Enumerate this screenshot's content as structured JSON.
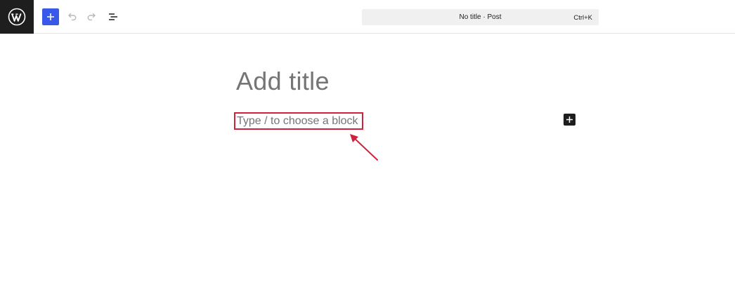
{
  "header": {
    "logo_icon": "wordpress-icon",
    "add_block_icon": "plus-icon",
    "undo_icon": "undo-icon",
    "redo_icon": "redo-icon",
    "document_overview_icon": "list-view-icon",
    "command_bar": {
      "title": "No title · Post",
      "shortcut": "Ctrl+K"
    }
  },
  "editor": {
    "title_placeholder": "Add title",
    "block_placeholder": "Type / to choose a block",
    "inserter_icon": "plus-icon"
  },
  "colors": {
    "accent": "#3858e9",
    "dark": "#1e1e1e",
    "annotation": "#d0223a",
    "placeholder": "#757575"
  }
}
